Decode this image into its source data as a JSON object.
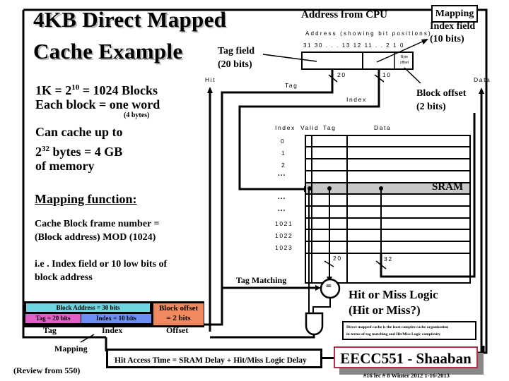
{
  "title": {
    "line1": "4KB Direct Mapped",
    "line2": "Cache  Example"
  },
  "left_notes": {
    "blocks_prefix": "1K = 2",
    "blocks_exp": "10",
    "blocks_suffix": " = 1024 Blocks",
    "each_block": "Each block = one word",
    "word_bytes": "(4 bytes)",
    "can_cache": "Can cache up to",
    "bytes_base": "2",
    "bytes_exp": "32",
    "bytes_suffix": " bytes =  4 GB",
    "of_memory": "of memory"
  },
  "mapping_function": {
    "heading": "Mapping function:",
    "line1": "Cache Block frame number =",
    "line2": "(Block address) MOD (1024)",
    "line3": "i.e . Index field or 10 low bits of",
    "line4": "block address"
  },
  "address": {
    "heading": "Address from  CPU",
    "subheading": "Address (showing bit positions)",
    "bit_positions": "31 30 . . . 13 12 11   . . 2 1 0",
    "byte_offset_label": "Byte offset",
    "tag_field": "Tag field",
    "tag_field_bits": "(20 bits)",
    "index_mapping": "Mapping",
    "index_field": "Index field",
    "index_field_bits": "(10 bits)",
    "block_offset": "Block offset",
    "block_offset_bits": "(2 bits)"
  },
  "wires": {
    "hit": "Hit",
    "tag": "Tag",
    "index": "Index",
    "data": "Data",
    "tag_width": "20",
    "index_width": "10",
    "compare_width": "20",
    "data_width": "32",
    "tag_matching": "Tag Matching",
    "equals": "="
  },
  "sram": {
    "label": "SRAM",
    "columns": [
      "Index",
      "Valid",
      "Tag",
      "Data"
    ],
    "rows": [
      "0",
      "1",
      "2",
      "...",
      "",
      "...",
      "...",
      "1021",
      "1022",
      "1023"
    ],
    "highlight_color": "#c8c8c8"
  },
  "hit_miss": {
    "line1": "Hit or Miss Logic",
    "line2": "(Hit or Miss?)",
    "note_line1": "Direct mapped cache is the least complex cache organization",
    "note_line2": "in terms of tag matching and Hit/Miss Logic complexity"
  },
  "address_breakdown": {
    "block_address": "Block Address  = 30 bits",
    "tag": "Tag  = 20 bits",
    "index": "Index  = 10 bits",
    "block_offset_line1": "Block offset",
    "block_offset_line2": "=  2 bits",
    "label_tag": "Tag",
    "label_index": "Index",
    "label_offset": "Offset",
    "mapping": "Mapping",
    "colors": {
      "block_address": "#6dd6e0",
      "tag": "#e060c8",
      "index": "#6c8ef0",
      "offset": "#f08a5e"
    }
  },
  "footer": {
    "review": "(Review from 550)",
    "hit_access_time": "Hit Access Time = SRAM Delay + Hit/Miss Logic Delay",
    "course": "EECC551 - Shaaban",
    "slide_info": "#16   lec # 8   Winter 2012  1-16-2013",
    "course_border_color": "#b0304a"
  }
}
